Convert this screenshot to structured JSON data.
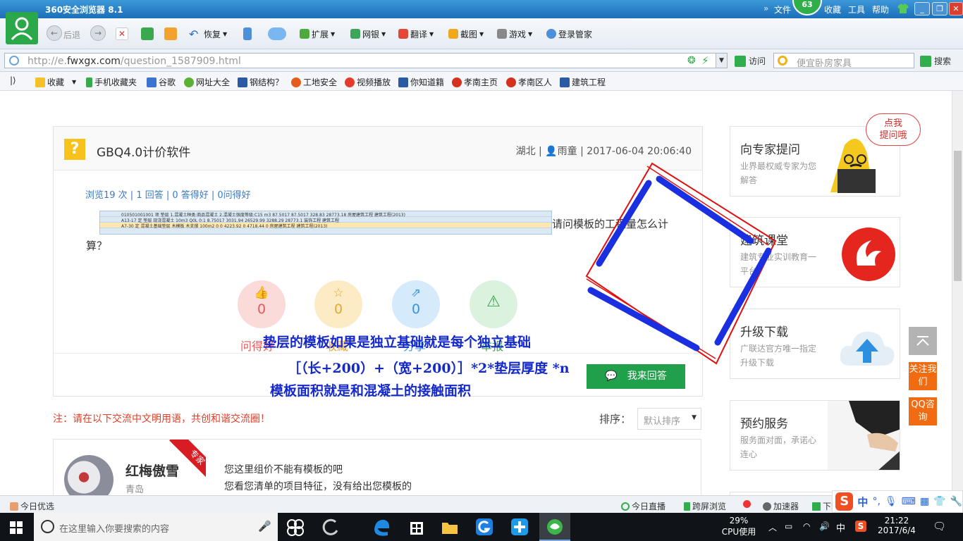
{
  "browser": {
    "title": "360安全浏览器 8.1",
    "menu": [
      "文件",
      "收藏",
      "工具",
      "帮助"
    ],
    "badge": "63",
    "toolbar": {
      "back": "后退",
      "restore": "恢复",
      "extend": "扩展",
      "netbank": "网银",
      "translate": "翻译",
      "screenshot": "截图",
      "games": "游戏",
      "login_manager": "登录管家"
    },
    "url_prefix": "http://e.",
    "url_host": "fwxgx.com",
    "url_path": "/question_1587909.html",
    "visit_label": "访问",
    "search_placeholder": "便宜卧房家具",
    "search_button": "搜索",
    "bookmarks": [
      "收藏",
      "手机收藏夹",
      "谷歌",
      "网址大全",
      "钢结构？",
      "工地安全",
      "视频播放",
      "你知道籍",
      "孝南主页",
      "孝南区人",
      "建筑工程"
    ]
  },
  "question": {
    "title": "GBQ4.0计价软件",
    "region": "湖北",
    "author": "雨童",
    "datetime": "2017-06-04 20:06:40",
    "stats": "浏览19 次 | 1 回答 | 0 答得好 | 0问得好",
    "body_line1": "请问模板的工程量怎么计",
    "body_line2": "算？",
    "table_rows": [
      "010501001001  项  垫层  1.混凝土种类:商品混凝土 2.混凝土强度等级:C15  m3  87.5017  87.5017  328.83  28773.18  房屋建筑工程  建筑工程(2013)",
      "A13-17  定  垫层 现浇混凝土  10m3  Q0L  0:1  8.75017  3031.94  26529.99  3288.29  28773.1  装饰工程  建筑工程",
      "A7-30  定  混凝土基础垫层 木模板 木支撑  100m2  0  0  4223.92  0  4718.44  0  房屋建筑工程  建筑工程(2013)"
    ],
    "actions": [
      {
        "count": "0",
        "label": "问得好"
      },
      {
        "count": "0",
        "label": "收藏"
      },
      {
        "count": "0",
        "label": "分享"
      },
      {
        "count": "0",
        "label": "举报"
      }
    ],
    "answer_button": "我来回答"
  },
  "annotation": {
    "line1": "垫层的模板如果是独立基础就是每个独立基础",
    "line2": "［（长+200）+（宽+200）］*2*垫层厚度  *n",
    "line3": "模板面积就是和混凝土的接触面积"
  },
  "notice": "注：请在以下交流中文明用语，共创和谐交流圈！",
  "sort": {
    "label": "排序：",
    "selected": "默认排序"
  },
  "answer": {
    "user": "红梅傲雪",
    "city": "青岛",
    "ribbon": "专家",
    "line1": "您这里组价不能有模板的吧",
    "line2": "您看您清单的项目特征，没有给出您模板的"
  },
  "sidebar": {
    "bubble": "点我\n提问哦",
    "cards": [
      {
        "title": "向专家提问",
        "desc": "业界最权威专家为您解答"
      },
      {
        "title": "建筑课堂",
        "desc": "建筑专业实训教育一平台"
      },
      {
        "title": "升级下载",
        "desc": "广联达官方唯一指定升级下载"
      },
      {
        "title": "预约服务",
        "desc": "服务面对面，承诺心连心"
      }
    ],
    "follow": "关注我们",
    "qq": "QQ咨询"
  },
  "statusbar": {
    "left": "今日优选",
    "live": "今日直播",
    "cross_screen": "跨屏浏览",
    "accelerator": "加速器",
    "download": "下载",
    "ime_lang": "中"
  },
  "taskbar": {
    "search_placeholder": "在这里输入你要搜索的内容",
    "cpu_percent": "29%",
    "cpu_label": "CPU使用",
    "ime": "中",
    "time": "21:22",
    "date": "2017/6/4"
  },
  "colors": {
    "accent_green": "#20a04a",
    "link_blue": "#3a7bc8",
    "annotation_blue": "#1429c8",
    "annotation_red": "#e01010",
    "notice_red": "#e2402a",
    "side_orange": "#f06b12"
  }
}
